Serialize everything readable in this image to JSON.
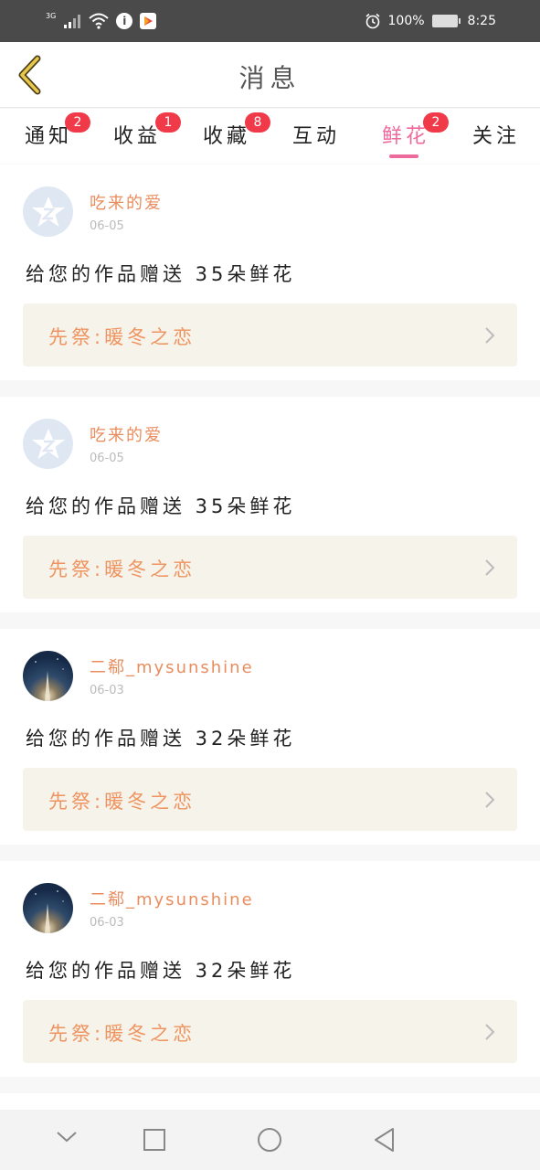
{
  "status_bar": {
    "network_label": "3G",
    "battery_text": "100%",
    "time": "8:25",
    "icons": [
      "signal-icon",
      "wifi-icon",
      "info-icon",
      "app-icon",
      "alarm-icon",
      "battery-icon"
    ]
  },
  "header": {
    "title": "消息",
    "back_icon": "chevron-left-icon",
    "accent_color": "#e8c84a"
  },
  "tabs": [
    {
      "label": "通知",
      "badge": "2"
    },
    {
      "label": "收益",
      "badge": "1"
    },
    {
      "label": "收藏",
      "badge": "8"
    },
    {
      "label": "互动",
      "badge": ""
    },
    {
      "label": "鲜花",
      "badge": "2",
      "active": true
    },
    {
      "label": "关注",
      "badge": ""
    }
  ],
  "colors": {
    "active_tab": "#ee6a9c",
    "badge": "#f03a4a",
    "username": "#e98d5e",
    "work_title": "#ef9461",
    "work_bg": "#f5f3ea"
  },
  "messages": [
    {
      "username": "吃来的爱",
      "date": "06-05",
      "text": "给您的作品赠送 35朵鲜花",
      "work": "先祭:暖冬之恋",
      "avatar": "default"
    },
    {
      "username": "吃来的爱",
      "date": "06-05",
      "text": "给您的作品赠送 35朵鲜花",
      "work": "先祭:暖冬之恋",
      "avatar": "default"
    },
    {
      "username": "二郗_mysunshine",
      "date": "06-03",
      "text": "给您的作品赠送 32朵鲜花",
      "work": "先祭:暖冬之恋",
      "avatar": "photo"
    },
    {
      "username": "二郗_mysunshine",
      "date": "06-03",
      "text": "给您的作品赠送 32朵鲜花",
      "work": "先祭:暖冬之恋",
      "avatar": "photo"
    }
  ],
  "nav_bar": {
    "icons": [
      "collapse-icon",
      "recent-apps-icon",
      "home-icon",
      "back-icon"
    ]
  }
}
